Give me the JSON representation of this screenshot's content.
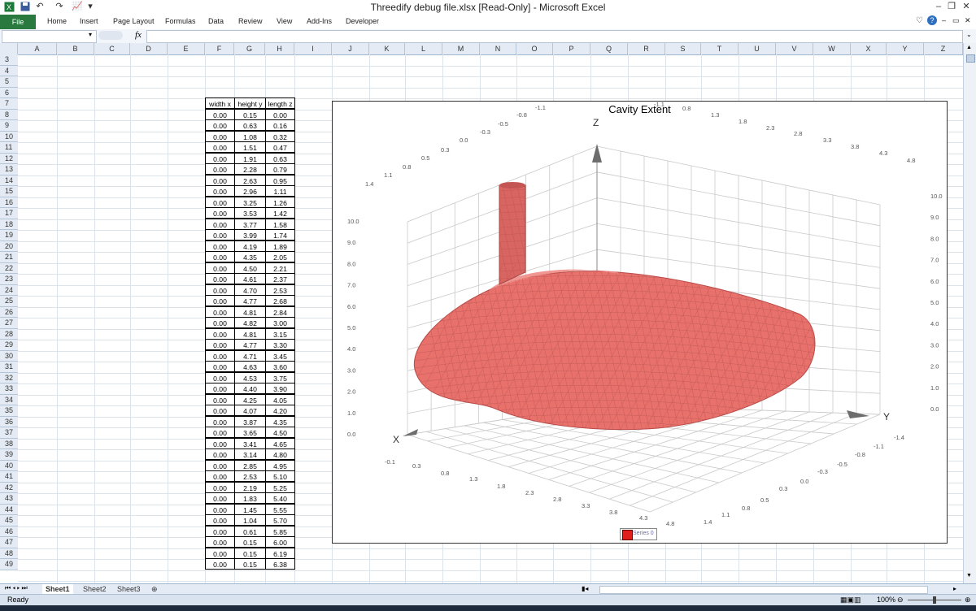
{
  "window": {
    "title": "Threedify debug file.xlsx  [Read-Only]  -  Microsoft Excel",
    "controls": {
      "minimize": "–",
      "restore": "❐",
      "close": "✕"
    }
  },
  "ribbon": {
    "tabs": [
      "File",
      "Home",
      "Insert",
      "Page Layout",
      "Formulas",
      "Data",
      "Review",
      "View",
      "Add-Ins",
      "Developer"
    ],
    "accent_color": "#2a7a3f"
  },
  "formula_bar": {
    "name_box": "",
    "fx_label": "fx",
    "content": ""
  },
  "columns": [
    "A",
    "B",
    "C",
    "D",
    "E",
    "F",
    "G",
    "H",
    "I",
    "J",
    "K",
    "L",
    "M",
    "N",
    "O",
    "P",
    "Q",
    "R",
    "S",
    "T",
    "U",
    "V",
    "W",
    "X",
    "Y",
    "Z"
  ],
  "rows": [
    3,
    4,
    5,
    6,
    7,
    8,
    9,
    10,
    11,
    12,
    13,
    14,
    15,
    16,
    17,
    18,
    19,
    20,
    21,
    22,
    23,
    24,
    25,
    26,
    27,
    28,
    29,
    30,
    31,
    32,
    33,
    34,
    35,
    36,
    37,
    38,
    39,
    40,
    41,
    42,
    43,
    44,
    45,
    46,
    47,
    48,
    49
  ],
  "table": {
    "headers": [
      "width x",
      "height y",
      "length z"
    ],
    "rows": [
      [
        "0.00",
        "0.15",
        "0.00"
      ],
      [
        "0.00",
        "0.63",
        "0.16"
      ],
      [
        "0.00",
        "1.08",
        "0.32"
      ],
      [
        "0.00",
        "1.51",
        "0.47"
      ],
      [
        "0.00",
        "1.91",
        "0.63"
      ],
      [
        "0.00",
        "2.28",
        "0.79"
      ],
      [
        "0.00",
        "2.63",
        "0.95"
      ],
      [
        "0.00",
        "2.96",
        "1.11"
      ],
      [
        "0.00",
        "3.25",
        "1.26"
      ],
      [
        "0.00",
        "3.53",
        "1.42"
      ],
      [
        "0.00",
        "3.77",
        "1.58"
      ],
      [
        "0.00",
        "3.99",
        "1.74"
      ],
      [
        "0.00",
        "4.19",
        "1.89"
      ],
      [
        "0.00",
        "4.35",
        "2.05"
      ],
      [
        "0.00",
        "4.50",
        "2.21"
      ],
      [
        "0.00",
        "4.61",
        "2.37"
      ],
      [
        "0.00",
        "4.70",
        "2.53"
      ],
      [
        "0.00",
        "4.77",
        "2.68"
      ],
      [
        "0.00",
        "4.81",
        "2.84"
      ],
      [
        "0.00",
        "4.82",
        "3.00"
      ],
      [
        "0.00",
        "4.81",
        "3.15"
      ],
      [
        "0.00",
        "4.77",
        "3.30"
      ],
      [
        "0.00",
        "4.71",
        "3.45"
      ],
      [
        "0.00",
        "4.63",
        "3.60"
      ],
      [
        "0.00",
        "4.53",
        "3.75"
      ],
      [
        "0.00",
        "4.40",
        "3.90"
      ],
      [
        "0.00",
        "4.25",
        "4.05"
      ],
      [
        "0.00",
        "4.07",
        "4.20"
      ],
      [
        "0.00",
        "3.87",
        "4.35"
      ],
      [
        "0.00",
        "3.65",
        "4.50"
      ],
      [
        "0.00",
        "3.41",
        "4.65"
      ],
      [
        "0.00",
        "3.14",
        "4.80"
      ],
      [
        "0.00",
        "2.85",
        "4.95"
      ],
      [
        "0.00",
        "2.53",
        "5.10"
      ],
      [
        "0.00",
        "2.19",
        "5.25"
      ],
      [
        "0.00",
        "1.83",
        "5.40"
      ],
      [
        "0.00",
        "1.45",
        "5.55"
      ],
      [
        "0.00",
        "1.04",
        "5.70"
      ],
      [
        "0.00",
        "0.61",
        "5.85"
      ],
      [
        "0.00",
        "0.15",
        "6.00"
      ],
      [
        "0.00",
        "0.15",
        "6.19"
      ],
      [
        "0.00",
        "0.15",
        "6.38"
      ]
    ]
  },
  "chart": {
    "title": "Cavity Extent",
    "axis_labels": {
      "x": "X",
      "y": "Y",
      "z": "Z"
    },
    "left_z_ticks": [
      "10.0",
      "9.0",
      "8.0",
      "7.0",
      "6.0",
      "5.0",
      "4.0",
      "3.0",
      "2.0",
      "1.0",
      "0.0"
    ],
    "right_z_ticks": [
      "10.0",
      "9.0",
      "8.0",
      "7.0",
      "6.0",
      "5.0",
      "4.0",
      "3.0",
      "2.0",
      "1.0",
      "0.0"
    ],
    "top_arc_ticks": [
      "1.4",
      "1.1",
      "0.8",
      "0.5",
      "0.3",
      "0.0",
      "-0.3",
      "-0.5",
      "-0.8",
      "-1.1"
    ],
    "top_x_ticks": [
      "-1.1",
      "0.8",
      "1.3",
      "1.8",
      "2.3",
      "2.8",
      "3.3",
      "3.8",
      "4.3",
      "4.8"
    ],
    "bottom_x_ticks": [
      "-0.1",
      "0.3",
      "0.8",
      "1.3",
      "1.8",
      "2.3",
      "2.8",
      "3.3",
      "3.8",
      "4.3",
      "4.8"
    ],
    "bottom_y_ticks": [
      "1.4",
      "1.1",
      "0.8",
      "0.5",
      "0.3",
      "0.0",
      "-0.3",
      "-0.5",
      "-0.8",
      "-1.1",
      "-1.4"
    ],
    "surface_color": "#e8716c",
    "legend": {
      "label": "Series 0",
      "color": "#e0201c"
    }
  },
  "sheets": {
    "tabs": [
      "Sheet1",
      "Sheet2",
      "Sheet3"
    ],
    "active": "Sheet1"
  },
  "status": {
    "text": "Ready",
    "zoom": "100%"
  }
}
